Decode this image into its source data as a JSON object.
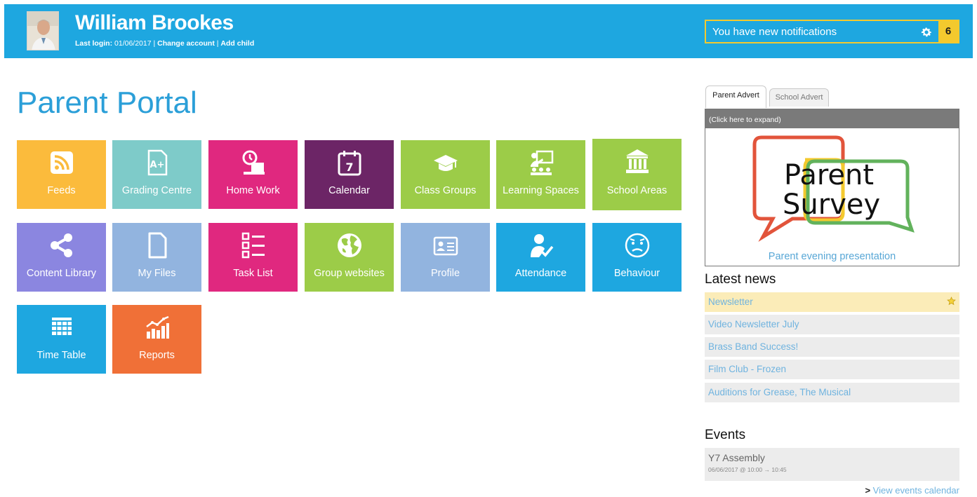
{
  "header": {
    "user_name": "William Brookes",
    "last_login_label": "Last login:",
    "last_login_date": "01/06/2017",
    "separator": "|",
    "change_account": "Change account",
    "add_child": "Add child",
    "notification_text": "You have new notifications",
    "notification_count": "6"
  },
  "page_title": "Parent Portal",
  "tiles": [
    {
      "label": "Feeds",
      "icon": "rss-icon",
      "color": "#fbbb3c"
    },
    {
      "label": "Grading Centre",
      "icon": "grade-document-icon",
      "color": "#7ecbc9"
    },
    {
      "label": "Home Work",
      "icon": "homework-desk-icon",
      "color": "#e0287f"
    },
    {
      "label": "Calendar",
      "icon": "calendar-icon",
      "color": "#6c2566"
    },
    {
      "label": "Class Groups",
      "icon": "graduation-cap-icon",
      "color": "#9ccc48"
    },
    {
      "label": "Learning Spaces",
      "icon": "classroom-icon",
      "color": "#9ccc48"
    },
    {
      "label": "School Areas",
      "icon": "building-icon",
      "color": "#9ccc48"
    },
    {
      "label": "Content Library",
      "icon": "share-icon",
      "color": "#8b86e0"
    },
    {
      "label": "My Files",
      "icon": "file-icon",
      "color": "#92b4df"
    },
    {
      "label": "Task List",
      "icon": "checklist-icon",
      "color": "#e0287f"
    },
    {
      "label": "Group websites",
      "icon": "globe-icon",
      "color": "#9ccc48"
    },
    {
      "label": "Profile",
      "icon": "id-card-icon",
      "color": "#92b4df"
    },
    {
      "label": "Attendance",
      "icon": "person-check-icon",
      "color": "#1ea7e0"
    },
    {
      "label": "Behaviour",
      "icon": "face-icon",
      "color": "#1ea7e0"
    },
    {
      "label": "Time Table",
      "icon": "grid-icon",
      "color": "#1ea7e0"
    },
    {
      "label": "Reports",
      "icon": "bar-chart-icon",
      "color": "#f07037"
    }
  ],
  "advert": {
    "tabs": [
      "Parent Advert",
      "School Advert"
    ],
    "expand_text": "(Click here to expand)",
    "image_line1": "Parent",
    "image_line2": "Survey",
    "caption": "Parent evening presentation"
  },
  "news": {
    "title": "Latest news",
    "items": [
      {
        "label": "Newsletter",
        "featured": true
      },
      {
        "label": "Video Newsletter July",
        "featured": false
      },
      {
        "label": "Brass Band Success!",
        "featured": false
      },
      {
        "label": "Film Club - Frozen",
        "featured": false
      },
      {
        "label": "Auditions for Grease, The Musical",
        "featured": false
      }
    ]
  },
  "events": {
    "title": "Events",
    "items": [
      {
        "title": "Y7 Assembly",
        "time": "06/06/2017 @ 10:00 → 10:45"
      }
    ],
    "view_calendar_arrow": ">",
    "view_calendar_label": "View events calendar"
  }
}
